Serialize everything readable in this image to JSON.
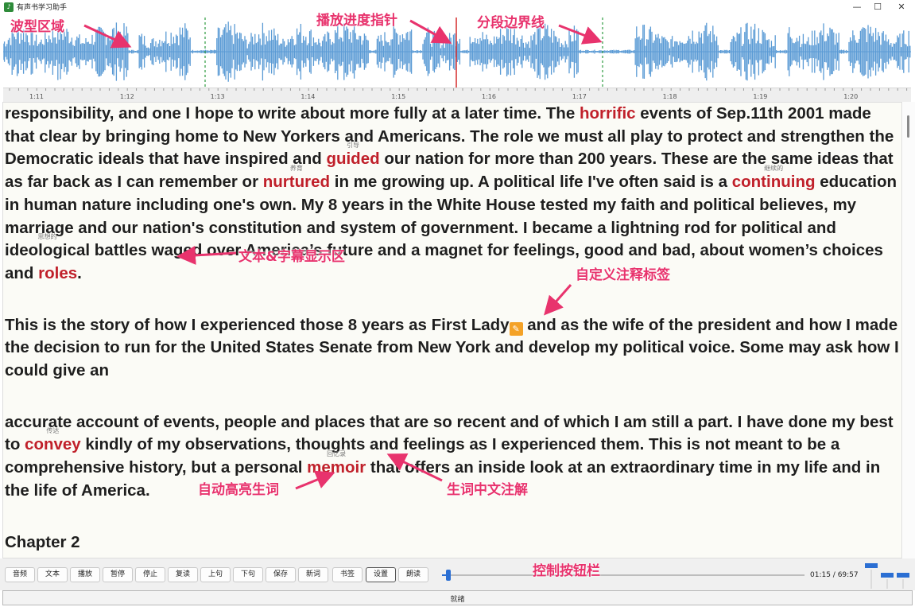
{
  "window": {
    "title": "有声书学习助手",
    "icon": "app-icon",
    "minimize": "—",
    "maximize": "☐",
    "close": "✕"
  },
  "waveform": {
    "color": "#5b9bd5",
    "time_ticks": [
      "1:11",
      "1:12",
      "1:13",
      "1:14",
      "1:15",
      "1:16",
      "1:17",
      "1:18",
      "1:19",
      "1:20"
    ],
    "playhead_color": "#d42a2a",
    "segment_boundary_color": "#2e9b3f"
  },
  "callouts": {
    "waveform": "波型区域",
    "playhead": "播放进度指针",
    "segment": "分段边界线",
    "text_area": "文本&字幕显示区",
    "custom_tag": "自定义注释标签",
    "auto_highlight": "自动高亮生词",
    "gloss": "生词中文注解",
    "control_bar": "控制按钮栏"
  },
  "text": {
    "p1": [
      {
        "t": "responsibility, and one I hope to write about more fully at a later time. The "
      },
      {
        "w": "horrific",
        "g": ""
      },
      {
        "t": " events of Sep.11th 2001 made that clear by bringing home to New Yorkers and Americans. The role we must all play to protect and strengthen the Democratic ideals that have inspired and "
      },
      {
        "w": "guided",
        "g": "引导"
      },
      {
        "t": " our nation for more than 200 years. These are the same ideas that as far back as I can remember or "
      },
      {
        "w": "nurtured",
        "g": "养育"
      },
      {
        "t": " in me growing up. A political life I've often said is a "
      },
      {
        "w": "continuing",
        "g": "继续的"
      },
      {
        "t": " education in human nature including one's own. My 8 years in the White House tested my faith and political believes, my marriage and our nation's constitution and system of government. I became a lightning rod for political and "
      },
      {
        "h": "ideological",
        "g": "思想的"
      },
      {
        "t": " battles waged over America’s future and a magnet for feelings, good and bad, about women’s choices and "
      },
      {
        "w": "roles",
        "g": ""
      },
      {
        "t": "."
      }
    ],
    "p2": [
      {
        "t": "This is the story of how I experienced those 8 years as First Lady"
      },
      {
        "tag": "🏷"
      },
      {
        "t": " and as the wife of the president and how I made the decision to run for the United States Senate from New York and develop my political voice. Some may ask how I could give an"
      }
    ],
    "p3": [
      {
        "t": "accurate account of events, people and places that are so recent and of which I am still a part. I have done my best to "
      },
      {
        "w": "convey",
        "g": "传达"
      },
      {
        "t": " kindly of my observations, "
      },
      {
        "h": "thoughts",
        "g": ""
      },
      {
        "t": " and feelings as I experienced them. This is not meant to be a comprehensive history, but a personal "
      },
      {
        "w": "memoir",
        "g": "回忆录"
      },
      {
        "t": " that offers an inside look at an extraordinary time in my life and in the life of America."
      }
    ],
    "chapter": "Chapter 2",
    "highlight_color": "#c0202a"
  },
  "controls": {
    "buttons": [
      "音频",
      "文本",
      "播放",
      "暂停",
      "停止",
      "复读",
      "上句",
      "下句",
      "保存",
      "新词",
      "书签",
      "设置",
      "朗读"
    ],
    "active_button": "设置",
    "time": "01:15 / 69:57",
    "progress_fraction": 0.018,
    "accent": "#2b6fd3"
  },
  "status": {
    "text": "就绪"
  }
}
